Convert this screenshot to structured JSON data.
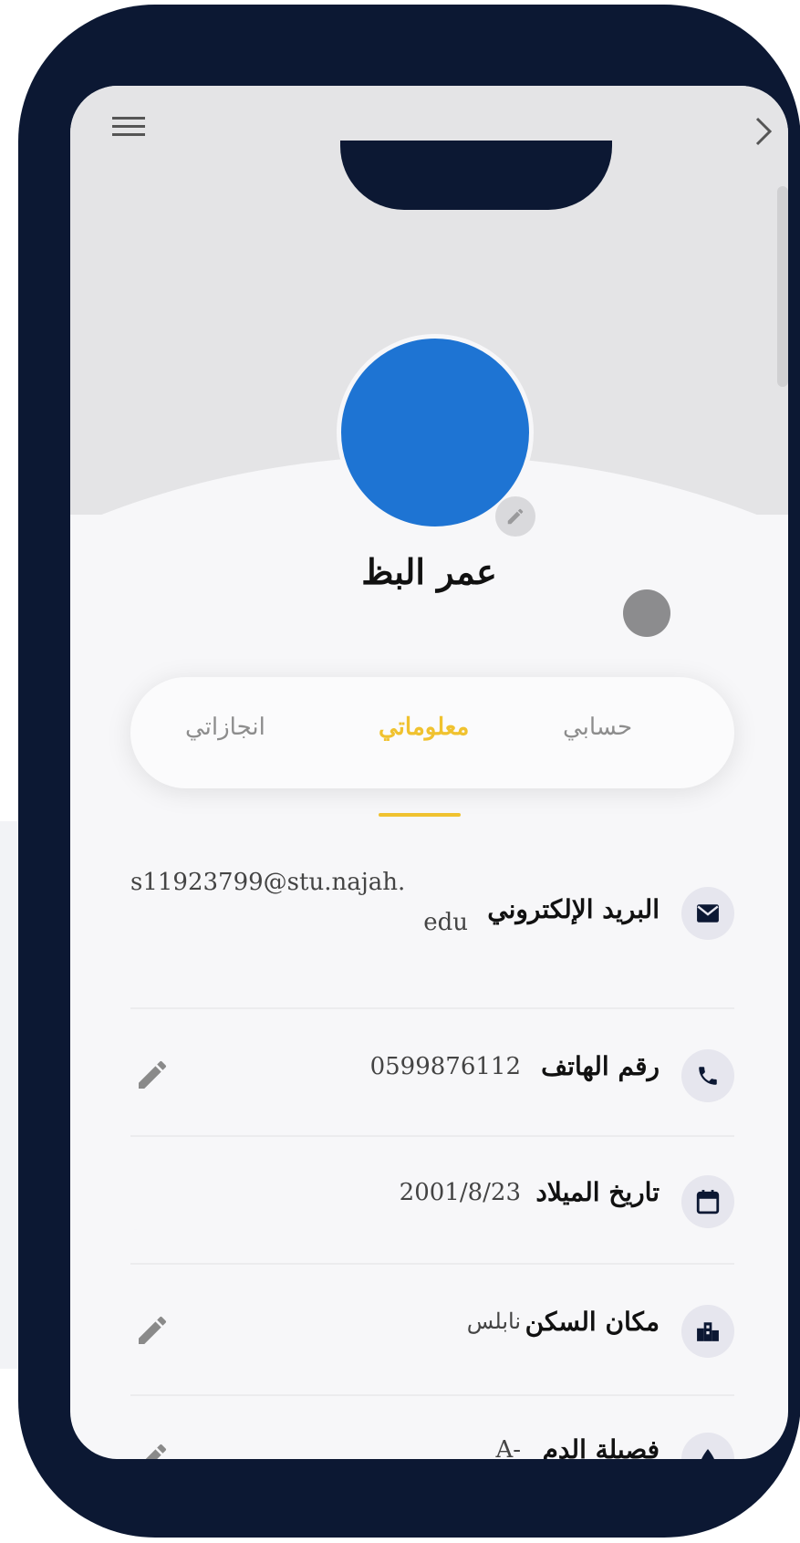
{
  "profile": {
    "name": "عمر البظ"
  },
  "tabs": [
    {
      "label": "حسابي",
      "active": false
    },
    {
      "label": "معلوماتي",
      "active": true
    },
    {
      "label": "انجازاتي",
      "active": false
    }
  ],
  "info": {
    "email": {
      "label": "البريد الإلكتروني",
      "value_line1": "s11923799@stu.najah.",
      "value_line2": "edu",
      "icon": "mail-icon"
    },
    "phone": {
      "label": "رقم الهاتف",
      "value": "0599876112",
      "icon": "phone-icon"
    },
    "birthdate": {
      "label": "تاريخ الميلاد",
      "value": "2001/8/23",
      "icon": "calendar-icon"
    },
    "residence": {
      "label": "مكان السكن",
      "value": "نابلس",
      "icon": "city-icon"
    },
    "blood_type": {
      "label": "فصيلة الدم",
      "value": "A-",
      "icon": "drop-icon"
    }
  },
  "colors": {
    "frame": "#0c1833",
    "avatar": "#1e74d3",
    "accent": "#f0c22f"
  }
}
